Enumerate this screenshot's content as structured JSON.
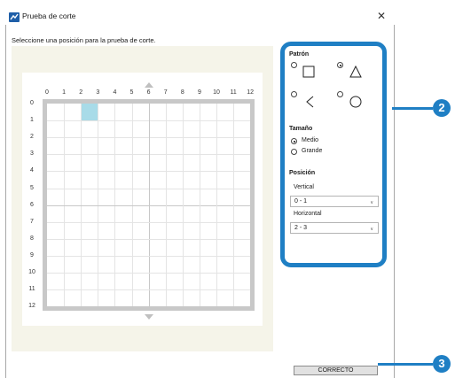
{
  "window": {
    "title": "Prueba de corte",
    "close_glyph": "✕",
    "title_icon": "app-icon"
  },
  "instruction": "Seleccione una posición para la prueba de corte.",
  "grid": {
    "columns": [
      "0",
      "1",
      "2",
      "3",
      "4",
      "5",
      "6",
      "7",
      "8",
      "9",
      "10",
      "11",
      "12"
    ],
    "rows": [
      "0",
      "1",
      "2",
      "3",
      "4",
      "5",
      "6",
      "7",
      "8",
      "9",
      "10",
      "11",
      "12"
    ],
    "selected_cell": {
      "col": 2,
      "row": 0
    }
  },
  "panel": {
    "pattern_heading": "Patrón",
    "pattern_options": [
      {
        "shape": "square",
        "selected": false
      },
      {
        "shape": "triangle",
        "selected": true
      },
      {
        "shape": "chevron-left",
        "selected": false
      },
      {
        "shape": "circle",
        "selected": false
      }
    ],
    "size_heading": "Tamaño",
    "size_options": [
      {
        "label": "Medio",
        "selected": true
      },
      {
        "label": "Grande",
        "selected": false
      }
    ],
    "position_heading": "Posición",
    "vertical_label": "Vertical",
    "vertical_value": "0 - 1",
    "horizontal_label": "Horizontal",
    "horizontal_value": "2 - 3"
  },
  "ok_button": "CORRECTO",
  "callouts": {
    "panel_number": "2",
    "button_number": "3"
  },
  "colors": {
    "accent": "#1f7fc4",
    "selected_cell": "#a8dbe8",
    "grid_area_bg": "#f5f4e9"
  }
}
